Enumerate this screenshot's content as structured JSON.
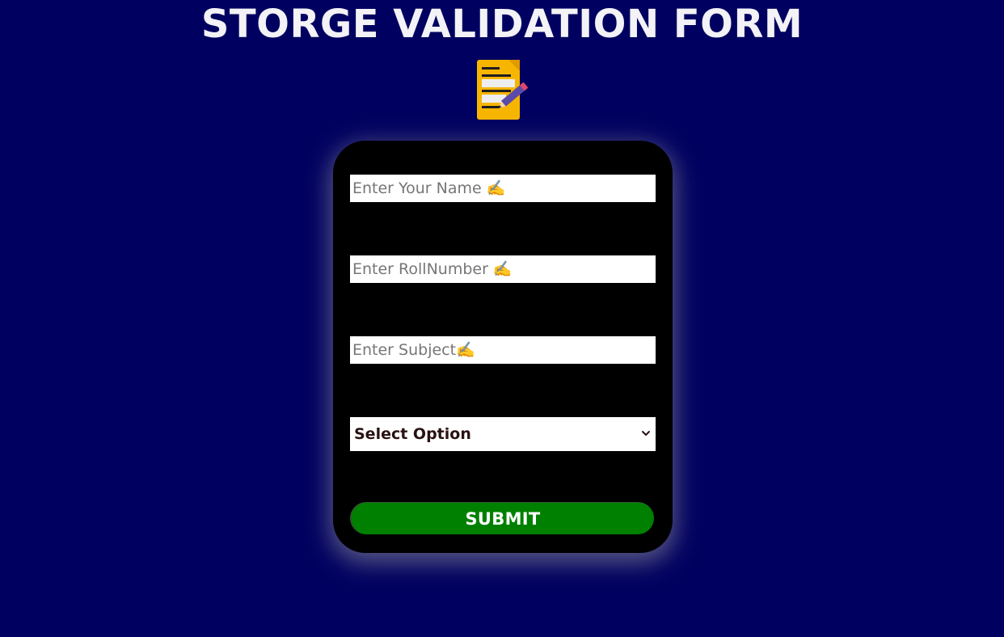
{
  "page": {
    "title": "STORGE VALIDATION FORM",
    "background_color": "#000060",
    "header_icon": "memo-icon"
  },
  "form": {
    "name_input": {
      "placeholder": "Enter Your Name ✍️",
      "value": ""
    },
    "roll_input": {
      "placeholder": "Enter RollNumber ✍️",
      "value": ""
    },
    "subject_input": {
      "placeholder": "Enter Subject✍️",
      "value": ""
    },
    "select": {
      "selected_label": "Select Option",
      "icon": "chevron-down-icon"
    },
    "submit_label": "SUBMIT",
    "card_color": "#000000",
    "submit_color": "#008000"
  }
}
